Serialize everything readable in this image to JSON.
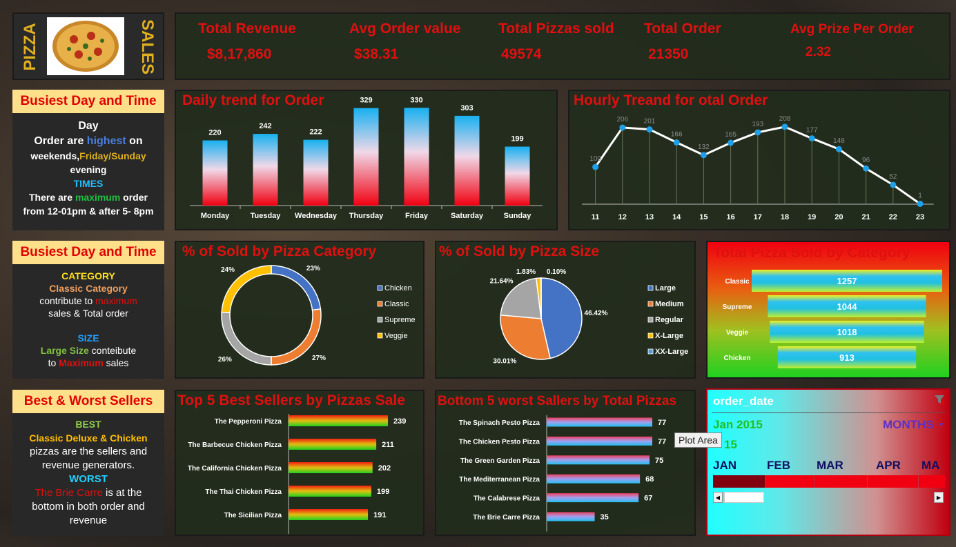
{
  "logo": {
    "left_text": "PIZZA",
    "right_text": "SALES"
  },
  "kpis": [
    {
      "label": "Total Revenue",
      "value": "$8,17,860"
    },
    {
      "label": "Avg Order value",
      "value": "$38.31"
    },
    {
      "label": "Total Pizzas sold",
      "value": "49574"
    },
    {
      "label": "Total Order",
      "value": "21350"
    },
    {
      "label": "Avg Prize Per Order",
      "value": "2.32"
    }
  ],
  "note1": {
    "header": "Busiest Day and Time",
    "day": "Day",
    "orders_a": "Order are ",
    "orders_b": "highest",
    "orders_c": " on",
    "weekends_a": "weekends,",
    "weekends_b": "Friday/Sunday",
    "evening": "evening",
    "times": "TIMES",
    "there_a": "There are ",
    "there_b": "maximum",
    "there_c": " order",
    "from": "from 12-01pm & after 5- 8pm"
  },
  "note2": {
    "header": "Busiest Day and Time",
    "category": "CATEGORY",
    "classic": "Classic Category",
    "contribute_a": "contribute to ",
    "contribute_b": "maximum",
    "sales": "sales & Total order",
    "size": "SIZE",
    "large_a": "Large Size",
    "large_b": " conteibute",
    "to_a": "to ",
    "to_b": "Maximum",
    "to_c": " sales"
  },
  "note3": {
    "header": "Best & Worst Sellers",
    "best": "BEST",
    "best_names": "Classic Deluxe & Chicken",
    "best_line2": "pizzas are the sellers and",
    "best_line3": "revenue generators.",
    "worst": "WORST",
    "worst_a": "The Brie Carre",
    "worst_b": " is at the",
    "worst_line2": "bottom in both order and",
    "worst_line3": "revenue"
  },
  "titles": {
    "daily": "Daily trend for Order",
    "hourly": "Hourly Treand for otal Order",
    "category_pct": "% of Sold by Pizza Category",
    "size_pct": "% of Sold by Pizza Size",
    "category_total": "Total Pizza Sold by Category",
    "top5": "Top 5 Best Sellers by Pizzas Sale",
    "bottom5": "Bottom 5 worst Sallers by Total Pizzas"
  },
  "chart_data": [
    {
      "id": "daily",
      "type": "bar",
      "title": "Daily trend for Order",
      "categories": [
        "Monday",
        "Tuesday",
        "Wednesday",
        "Thursday",
        "Friday",
        "Saturday",
        "Sunday"
      ],
      "values": [
        220,
        242,
        222,
        329,
        330,
        303,
        199
      ],
      "ylim": [
        0,
        340
      ]
    },
    {
      "id": "hourly",
      "type": "line",
      "title": "Hourly Treand for otal Order",
      "x": [
        "11",
        "12",
        "13",
        "14",
        "15",
        "16",
        "17",
        "18",
        "19",
        "20",
        "21",
        "22",
        "23"
      ],
      "values": [
        100,
        206,
        201,
        166,
        132,
        165,
        193,
        208,
        177,
        148,
        96,
        52,
        1
      ],
      "ylim": [
        0,
        230
      ]
    },
    {
      "id": "category_pct",
      "type": "pie",
      "title": "% of Sold by Pizza Category",
      "labels": [
        "Chicken",
        "Classic",
        "Supreme",
        "Veggie"
      ],
      "values": [
        23,
        27,
        26,
        24
      ],
      "value_labels": [
        "23%",
        "27%",
        "26%",
        "24%"
      ],
      "colors": [
        "#4472c4",
        "#ed7d31",
        "#a5a5a5",
        "#ffc000"
      ]
    },
    {
      "id": "size_pct",
      "type": "pie",
      "title": "% of Sold by Pizza Size",
      "labels": [
        "Large",
        "Medium",
        "Regular",
        "X-Large",
        "XX-Large"
      ],
      "values": [
        46.42,
        30.01,
        21.64,
        1.83,
        0.1
      ],
      "value_labels": [
        "46.42%",
        "30.01%",
        "21.64%",
        "1.83%",
        "0.10%"
      ],
      "colors": [
        "#4472c4",
        "#ed7d31",
        "#a5a5a5",
        "#ffc000",
        "#5b9bd5"
      ]
    },
    {
      "id": "category_total",
      "type": "bar",
      "title": "Total Pizza Sold by Category",
      "categories": [
        "Classic",
        "Supreme",
        "Veggie",
        "Chicken"
      ],
      "values": [
        1257,
        1044,
        1018,
        913
      ]
    },
    {
      "id": "top5",
      "type": "bar",
      "title": "Top 5 Best Sellers by Pizzas Sale",
      "categories": [
        "The Pepperoni Pizza",
        "The Barbecue Chicken Pizza",
        "The California Chicken Pizza",
        "The Thai Chicken Pizza",
        "The Sicilian Pizza"
      ],
      "values": [
        239,
        211,
        202,
        199,
        191
      ]
    },
    {
      "id": "bottom5",
      "type": "bar",
      "title": "Bottom 5 worst Sallers by Total Pizzas",
      "categories": [
        "The Spinach Pesto Pizza",
        "The Chicken Pesto Pizza",
        "The Green Garden Pizza",
        "The Mediterranean Pizza",
        "The Calabrese Pizza",
        "The Brie Carre Pizza"
      ],
      "values": [
        77,
        77,
        75,
        68,
        67,
        35
      ]
    }
  ],
  "slicer": {
    "header": "order_date",
    "selected": "Jan 2015",
    "level": "MONTHS",
    "year_fragment": "15",
    "months": [
      "JAN",
      "FEB",
      "MAR",
      "APR",
      "MA"
    ],
    "tooltip": "Plot Area"
  },
  "colors": {
    "kpi_red": "#e01010",
    "note_header_bg": "#ffe08a",
    "panel_bg": "#222c1c"
  }
}
